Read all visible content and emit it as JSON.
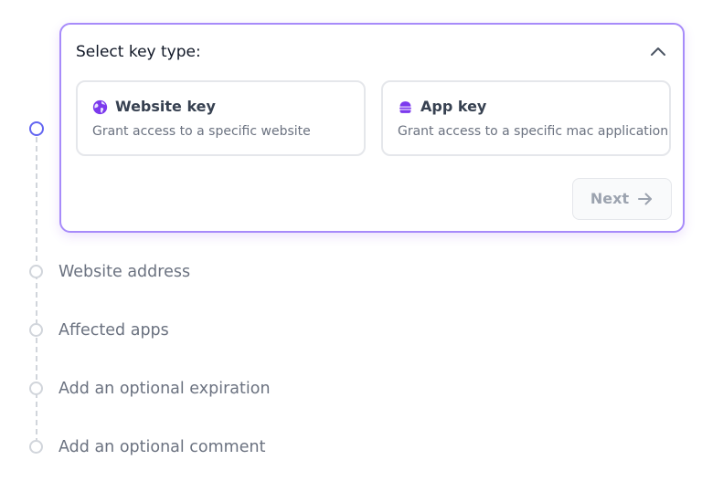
{
  "card": {
    "title": "Select key type:",
    "options": [
      {
        "title": "Website key",
        "description": "Grant access to a specific website",
        "icon": "globe-icon"
      },
      {
        "title": "App key",
        "description": "Grant access to a specific mac application",
        "icon": "app-stack-icon"
      }
    ],
    "next_label": "Next",
    "collapse_icon": "chevron-up-icon",
    "next_icon": "arrow-right-icon"
  },
  "steps": [
    {
      "label": "Website address"
    },
    {
      "label": "Affected apps"
    },
    {
      "label": "Add an optional expiration"
    },
    {
      "label": "Add an optional comment"
    }
  ],
  "colors": {
    "accent": "#a78bfa",
    "icon_purple": "#7c3aed",
    "active_dot": "#6366f1",
    "muted_text": "#6b7280"
  }
}
